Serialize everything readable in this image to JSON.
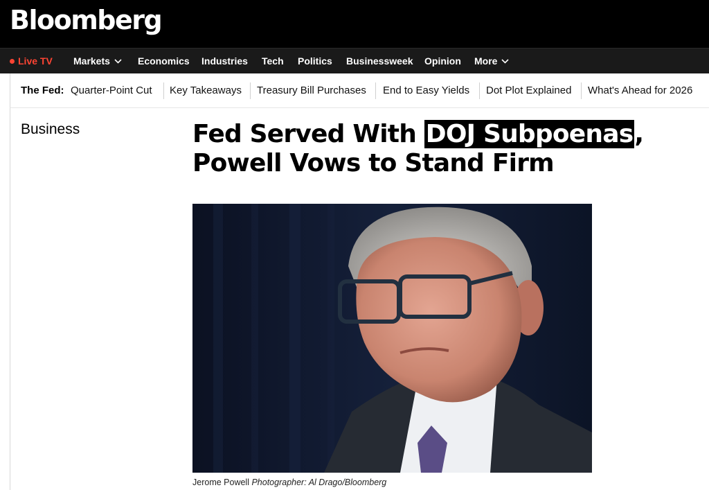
{
  "header": {
    "logo": "Bloomberg"
  },
  "nav": {
    "live_tv": "Live TV",
    "items": [
      "Markets",
      "Economics",
      "Industries",
      "Tech",
      "Politics",
      "Businessweek",
      "Opinion",
      "More"
    ]
  },
  "subnav": {
    "label": "The Fed:",
    "items": [
      "Quarter-Point Cut",
      "Key Takeaways",
      "Treasury Bill Purchases",
      "End to Easy Yields",
      "Dot Plot Explained",
      "What's Ahead for 2026"
    ]
  },
  "article": {
    "section": "Business",
    "headline_part1": "Fed Served With ",
    "headline_highlight": "DOJ Subpoenas",
    "headline_part2": ", Powell Vows to Stand Firm",
    "image_caption": "Jerome Powell",
    "image_credit": "Photographer: Al Drago/Bloomberg"
  },
  "colors": {
    "accent_live": "#ff4433",
    "header_bg": "#000000",
    "nav_bg": "#1a1a1a"
  }
}
